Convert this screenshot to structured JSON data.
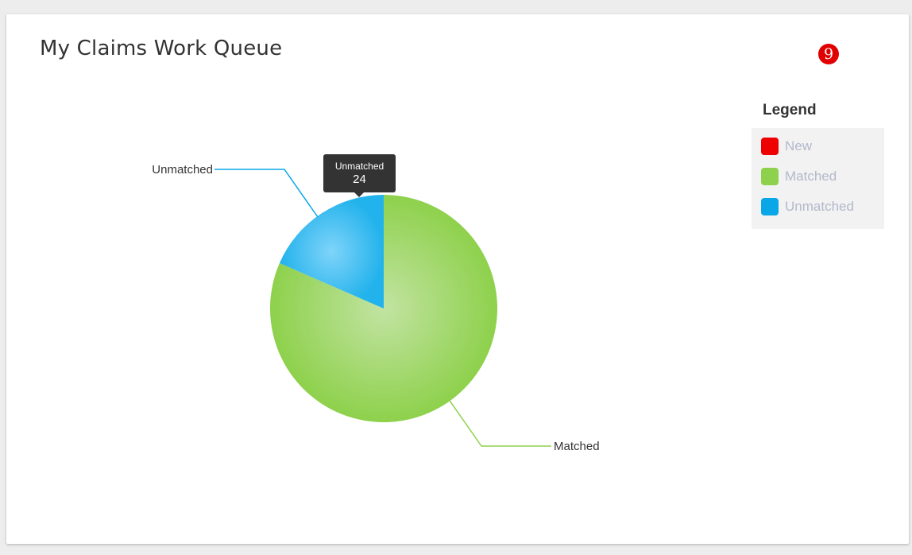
{
  "widget": {
    "title": "My Claims Work Queue",
    "step_badge": "9"
  },
  "legend": {
    "title": "Legend",
    "items": [
      {
        "label": "New",
        "color": "#ee0000"
      },
      {
        "label": "Matched",
        "color": "#8ed14c"
      },
      {
        "label": "Unmatched",
        "color": "#0aa7e8"
      }
    ]
  },
  "tooltip": {
    "label": "Unmatched",
    "value": "24"
  },
  "chart_data": {
    "type": "pie",
    "categories": [
      "Matched",
      "Unmatched"
    ],
    "values": [
      106,
      24
    ],
    "colors": [
      "#8ed14c",
      "#0aa7e8"
    ],
    "slice_labels": [
      "Matched",
      "Unmatched"
    ],
    "legend_position": "top-right"
  }
}
